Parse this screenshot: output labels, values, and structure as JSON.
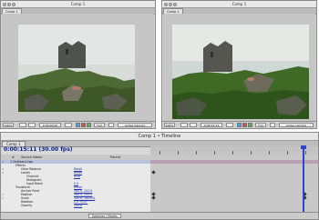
{
  "viewers": [
    {
      "title": "Comp 1",
      "tab": "Comp 1",
      "zoom": "100%",
      "time": "0:00:00:00",
      "resolution": "Full",
      "view": "Active Camera"
    },
    {
      "title": "Comp 1",
      "tab": "Comp 1",
      "zoom": "100%",
      "time": "0:00:15:11",
      "resolution": "Full",
      "view": "Active Camera"
    }
  ],
  "timeline": {
    "title": "Comp 1 • Timeline",
    "tab": "Comp 1",
    "current_time": "0:00:15:11 (30.00 fps)",
    "columns": [
      "#",
      "Source Name",
      "Parent"
    ],
    "rows": [
      {
        "label": "1  Chateau1.tga",
        "value": "",
        "indent": 10
      },
      {
        "label": "Effects",
        "value": "",
        "indent": 16
      },
      {
        "label": "Color Balance",
        "value": "Reset",
        "indent": 22
      },
      {
        "label": "Levels",
        "value": "Reset",
        "indent": 22
      },
      {
        "label": "Channel:",
        "value": "RGB",
        "indent": 28
      },
      {
        "label": "Histogram",
        "value": "",
        "indent": 28
      },
      {
        "label": "Input Black",
        "value": "0.0",
        "indent": 28
      },
      {
        "label": "Transform",
        "value": "Reset",
        "indent": 16
      },
      {
        "label": "Anchor Point",
        "value": "360.0, 243.0",
        "indent": 22
      },
      {
        "label": "Position",
        "value": "360.0, 243.0",
        "indent": 22
      },
      {
        "label": "Scale",
        "value": "100.0, 100.0%",
        "indent": 22
      },
      {
        "label": "Rotation",
        "value": "0 x +0.0°",
        "indent": 22
      },
      {
        "label": "Opacity",
        "value": "100%",
        "indent": 22
      }
    ],
    "switches_label": "Switches / Modes",
    "marker_color": "#2f45c8"
  }
}
